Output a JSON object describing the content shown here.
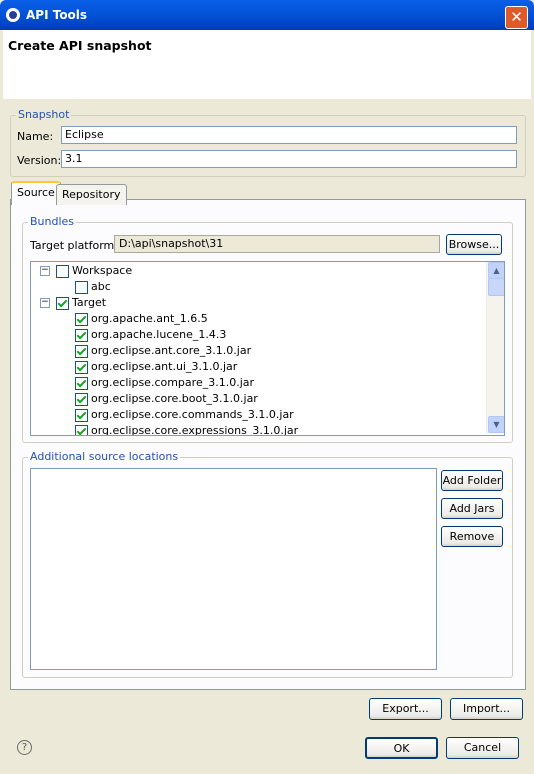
{
  "window": {
    "title": "API Tools",
    "close_label": "✕"
  },
  "header": {
    "title": "Create API snapshot"
  },
  "snapshot": {
    "legend": "Snapshot",
    "name_label": "Name:",
    "name_value": "Eclipse",
    "version_label": "Version:",
    "version_value": "3.1"
  },
  "tabs": [
    {
      "label": "Source",
      "active": true
    },
    {
      "label": "Repository",
      "active": false
    }
  ],
  "bundles": {
    "legend": "Bundles",
    "target_platform_label": "Target platform:",
    "target_platform_value": "D:\\api\\snapshot\\31",
    "browse_label": "Browse...",
    "tree": [
      {
        "label": "Workspace",
        "checked": false,
        "expander": "−",
        "level": 0
      },
      {
        "label": "abc",
        "checked": false,
        "level": 1
      },
      {
        "label": "Target",
        "checked": true,
        "expander": "−",
        "level": 0
      },
      {
        "label": "org.apache.ant_1.6.5",
        "checked": true,
        "level": 1
      },
      {
        "label": "org.apache.lucene_1.4.3",
        "checked": true,
        "level": 1
      },
      {
        "label": "org.eclipse.ant.core_3.1.0.jar",
        "checked": true,
        "level": 1
      },
      {
        "label": "org.eclipse.ant.ui_3.1.0.jar",
        "checked": true,
        "level": 1
      },
      {
        "label": "org.eclipse.compare_3.1.0.jar",
        "checked": true,
        "level": 1
      },
      {
        "label": "org.eclipse.core.boot_3.1.0.jar",
        "checked": true,
        "level": 1
      },
      {
        "label": "org.eclipse.core.commands_3.1.0.jar",
        "checked": true,
        "level": 1
      },
      {
        "label": "org.eclipse.core.expressions_3.1.0.jar",
        "checked": true,
        "level": 1
      }
    ]
  },
  "additional": {
    "legend": "Additional source locations",
    "add_folder_label": "Add Folder",
    "add_jars_label": "Add Jars",
    "remove_label": "Remove"
  },
  "footer": {
    "export_label": "Export...",
    "import_label": "Import...",
    "ok_label": "OK",
    "cancel_label": "Cancel",
    "help_label": "?"
  },
  "scroll": {
    "up": "▲",
    "down": "▼"
  }
}
